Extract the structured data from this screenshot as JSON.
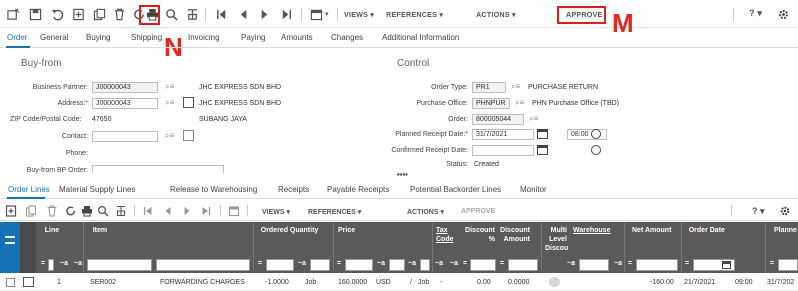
{
  "toolbar": {
    "views_label": "VIEWS ▾",
    "references_label": "REFERENCES ▾",
    "actions_label": "ACTIONS ▾",
    "approve_label": "APPROVE",
    "help_label": "? ▾"
  },
  "annotations": {
    "n_label": "N",
    "m_label": "M"
  },
  "tabs": [
    "Order",
    "General",
    "Buying",
    "Shipping",
    "Invoicing",
    "Paying",
    "Amounts",
    "Changes",
    "Additional Information"
  ],
  "buyfrom": {
    "title": "Buy-from",
    "business_partner_label": "Business Partner:",
    "business_partner_value": "J00000043",
    "business_partner_name": "JHC EXPRESS SDN BHD",
    "address_label": "Address:",
    "address_value": "J00000043",
    "address_name": "JHC EXPRESS SDN BHD",
    "zip_label": "ZIP Code/Postal Code:",
    "zip_value": "47650",
    "city_value": "SUBANG JAYA",
    "contact_label": "Contact:",
    "phone_label": "Phone:",
    "buyfrom_bp_label": "Buy-from BP Order:"
  },
  "control": {
    "title": "Control",
    "order_type_label": "Order Type:",
    "order_type_value": "PR1",
    "order_type_desc": "PURCHASE RETURN",
    "purchase_office_label": "Purchase Office:",
    "purchase_office_value": "PHNPUR",
    "purchase_office_desc": "PHN Purchase Office (TBD)",
    "order_label": "Order:",
    "order_value": "800005044",
    "planned_receipt_label": "Planned Receipt Date:",
    "planned_receipt_date": "31/7/2021",
    "planned_receipt_time": "08:00",
    "confirmed_receipt_label": "Confirmed Receipt Date:",
    "status_label": "Status:",
    "status_value": "Created",
    "masked": "****"
  },
  "lines_tabs": [
    "Order Lines",
    "Material Supply Lines",
    "Release to Warehousing",
    "Receipts",
    "Payable Receipts",
    "Potential Backorder Lines",
    "Monitor"
  ],
  "grid_toolbar": {
    "views_label": "VIEWS ▾",
    "references_label": "REFERENCES ▾",
    "actions_label": "ACTIONS ▾",
    "approve_label": "APPROVE",
    "help_label": "? ▾"
  },
  "grid": {
    "headers": {
      "line": "Line",
      "item": "Item",
      "ordered_quantity": "Ordered Quantity",
      "price": "Price",
      "tax_code_1": "Tax",
      "tax_code_2": "Code",
      "discount_pct_1": "Discount",
      "discount_pct_2": "%",
      "discount_amount_1": "Discount",
      "discount_amount_2": "Amount",
      "multi_level_1": "Multi",
      "multi_level_2": "Level",
      "multi_level_3": "Discou",
      "warehouse": "Warehouse",
      "net_amount": "Net Amount",
      "order_date": "Order Date",
      "planned": "Planne"
    },
    "rows": [
      {
        "line": "1",
        "item": "SER002",
        "description": "FORWARDING CHARGES",
        "qty": "-1.0000",
        "qty_unit": "Job",
        "price": "160.0000",
        "currency": "USD",
        "per": "/",
        "per_unit": "Job",
        "dash": "-",
        "discount_pct": "0.00",
        "discount_amount": "0.0000",
        "net_amount": "-160.00",
        "order_date": "21/7/2021",
        "order_time": "09:00",
        "planned": "31/7/202"
      }
    ]
  },
  "colors": {
    "accent": "#1673b5",
    "highlight": "#e21b1b",
    "grid_header": "#5a5a5a"
  }
}
